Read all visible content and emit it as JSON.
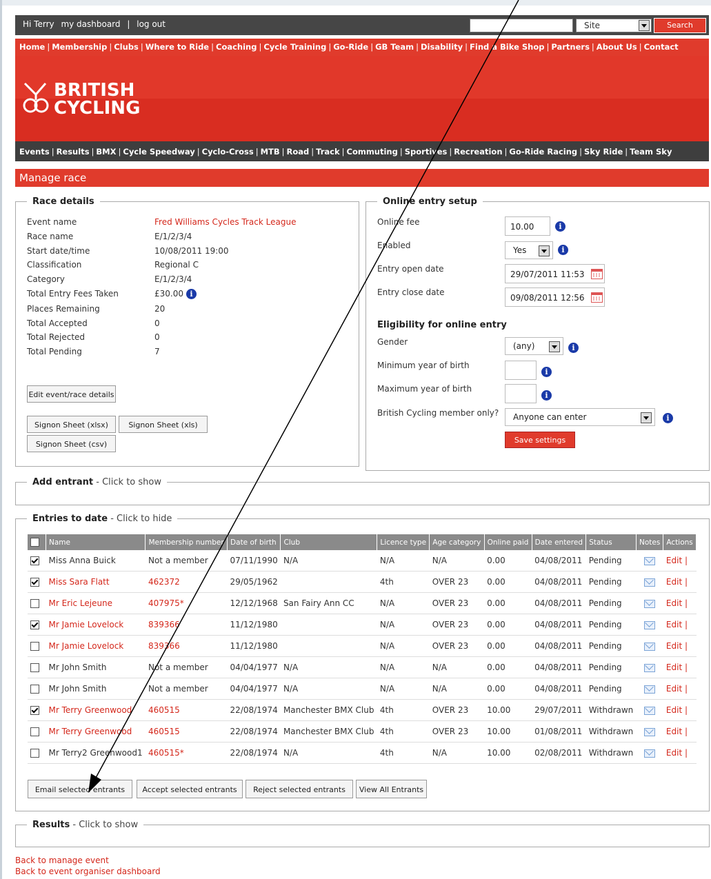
{
  "topbar": {
    "greeting": "Hi Terry",
    "dashboard_link": "my dashboard",
    "separator": "|",
    "logout_link": "log out",
    "site_select_value": "Site",
    "search_button": "Search"
  },
  "main_nav": [
    "Home",
    "Membership",
    "Clubs",
    "Where to Ride",
    "Coaching",
    "Cycle Training",
    "Go-Ride",
    "GB Team",
    "Disability",
    "Find a Bike Shop",
    "Partners",
    "About Us",
    "Contact"
  ],
  "logo": {
    "line1": "BRITISH",
    "line2": "CYCLING"
  },
  "sub_nav": [
    "Events",
    "Results",
    "BMX",
    "Cycle Speedway",
    "Cyclo-Cross",
    "MTB",
    "Road",
    "Track",
    "Commuting",
    "Sportives",
    "Recreation",
    "Go-Ride Racing",
    "Sky Ride",
    "Team Sky"
  ],
  "page_title": "Manage race",
  "race_details": {
    "legend": "Race details",
    "labels": [
      "Event name",
      "Race name",
      "Start date/time",
      "Classification",
      "Category",
      "Total Entry Fees Taken",
      "Places Remaining",
      "Total Accepted",
      "Total Rejected",
      "Total Pending"
    ],
    "values": [
      "Fred Williams Cycles Track League",
      "E/1/2/3/4",
      "10/08/2011 19:00",
      "Regional C",
      "E/1/2/3/4",
      "£30.00",
      "20",
      "0",
      "0",
      "7"
    ],
    "edit_button": "Edit event/race details",
    "signon_xlsx": "Signon Sheet (xlsx)",
    "signon_xls": "Signon Sheet (xls)",
    "signon_csv": "Signon Sheet (csv)"
  },
  "online_entry": {
    "legend": "Online entry setup",
    "fee_label": "Online fee",
    "fee_value": "10.00",
    "enabled_label": "Enabled",
    "enabled_value": "Yes",
    "open_label": "Entry open date",
    "open_value": "29/07/2011 11:53",
    "close_label": "Entry close date",
    "close_value": "09/08/2011 12:56",
    "eligibility_title": "Eligibility for online entry",
    "gender_label": "Gender",
    "gender_value": "(any)",
    "min_yob_label": "Minimum year of birth",
    "max_yob_label": "Maximum year of birth",
    "member_label": "British Cycling member only?",
    "member_value": "Anyone can enter",
    "save_button": "Save settings"
  },
  "add_entrant": {
    "legend": "Add entrant",
    "hint": " - Click to show"
  },
  "entries": {
    "legend": "Entries to date",
    "hint": " - Click to hide",
    "columns": [
      "Name",
      "Membership number",
      "Date of birth",
      "Club",
      "Licence type",
      "Age category",
      "Online paid",
      "Date entered",
      "Status",
      "Notes",
      "Actions"
    ],
    "rows": [
      {
        "checked": true,
        "name": "Miss Anna Buick",
        "name_link": false,
        "member": "Not a member",
        "member_link": false,
        "dob": "07/11/1990",
        "club": "N/A",
        "licence": "N/A",
        "age": "N/A",
        "paid": "0.00",
        "date": "04/08/2011",
        "status": "Pending",
        "action": "Edit |"
      },
      {
        "checked": true,
        "name": "Miss Sara Flatt",
        "name_link": true,
        "member": "462372",
        "member_link": true,
        "dob": "29/05/1962",
        "club": "",
        "licence": "4th",
        "age": "OVER 23",
        "paid": "0.00",
        "date": "04/08/2011",
        "status": "Pending",
        "action": "Edit |"
      },
      {
        "checked": false,
        "name": "Mr Eric Lejeune",
        "name_link": true,
        "member": "407975*",
        "member_link": true,
        "dob": "12/12/1968",
        "club": "San Fairy Ann CC",
        "licence": "N/A",
        "age": "OVER 23",
        "paid": "0.00",
        "date": "04/08/2011",
        "status": "Pending",
        "action": "Edit |"
      },
      {
        "checked": true,
        "name": "Mr Jamie Lovelock",
        "name_link": true,
        "member": "839366",
        "member_link": true,
        "dob": "11/12/1980",
        "club": "",
        "licence": "N/A",
        "age": "OVER 23",
        "paid": "0.00",
        "date": "04/08/2011",
        "status": "Pending",
        "action": "Edit |"
      },
      {
        "checked": false,
        "name": "Mr Jamie Lovelock",
        "name_link": true,
        "member": "839366",
        "member_link": true,
        "dob": "11/12/1980",
        "club": "",
        "licence": "N/A",
        "age": "OVER 23",
        "paid": "0.00",
        "date": "04/08/2011",
        "status": "Pending",
        "action": "Edit |"
      },
      {
        "checked": false,
        "name": "Mr John Smith",
        "name_link": false,
        "member": "Not a member",
        "member_link": false,
        "dob": "04/04/1977",
        "club": "N/A",
        "licence": "N/A",
        "age": "N/A",
        "paid": "0.00",
        "date": "04/08/2011",
        "status": "Pending",
        "action": "Edit |"
      },
      {
        "checked": false,
        "name": "Mr John Smith",
        "name_link": false,
        "member": "Not a member",
        "member_link": false,
        "dob": "04/04/1977",
        "club": "N/A",
        "licence": "N/A",
        "age": "N/A",
        "paid": "0.00",
        "date": "04/08/2011",
        "status": "Pending",
        "action": "Edit |"
      },
      {
        "checked": true,
        "name": "Mr Terry Greenwood",
        "name_link": true,
        "member": "460515",
        "member_link": true,
        "dob": "22/08/1974",
        "club": "Manchester BMX Club",
        "licence": "4th",
        "age": "OVER 23",
        "paid": "10.00",
        "date": "29/07/2011",
        "status": "Withdrawn",
        "action": "Edit |"
      },
      {
        "checked": false,
        "name": "Mr Terry Greenwood",
        "name_link": true,
        "member": "460515",
        "member_link": true,
        "dob": "22/08/1974",
        "club": "Manchester BMX Club",
        "licence": "4th",
        "age": "OVER 23",
        "paid": "10.00",
        "date": "01/08/2011",
        "status": "Withdrawn",
        "action": "Edit |"
      },
      {
        "checked": false,
        "name": "Mr Terry2 Greenwood1",
        "name_link": false,
        "member": "460515*",
        "member_link": true,
        "dob": "22/08/1974",
        "club": "N/A",
        "licence": "4th",
        "age": "N/A",
        "paid": "10.00",
        "date": "02/08/2011",
        "status": "Withdrawn",
        "action": "Edit |"
      }
    ],
    "email_button": "Email selected entrants",
    "accept_button": "Accept selected entrants",
    "reject_button": "Reject selected entrants",
    "view_all_button": "View All Entrants"
  },
  "results": {
    "legend": "Results",
    "hint": " - Click to show"
  },
  "footer": {
    "back_event": "Back to manage event",
    "back_dashboard": "Back to event organiser dashboard"
  },
  "colors": {
    "brand_red": "#e03b2c",
    "nav_dark": "#3e3e3e",
    "info_blue": "#1a3aa8"
  },
  "icons": [
    "info-icon",
    "calendar-icon",
    "mail-icon",
    "dropdown-arrow-icon",
    "checkbox-icon",
    "annotation-arrow"
  ]
}
